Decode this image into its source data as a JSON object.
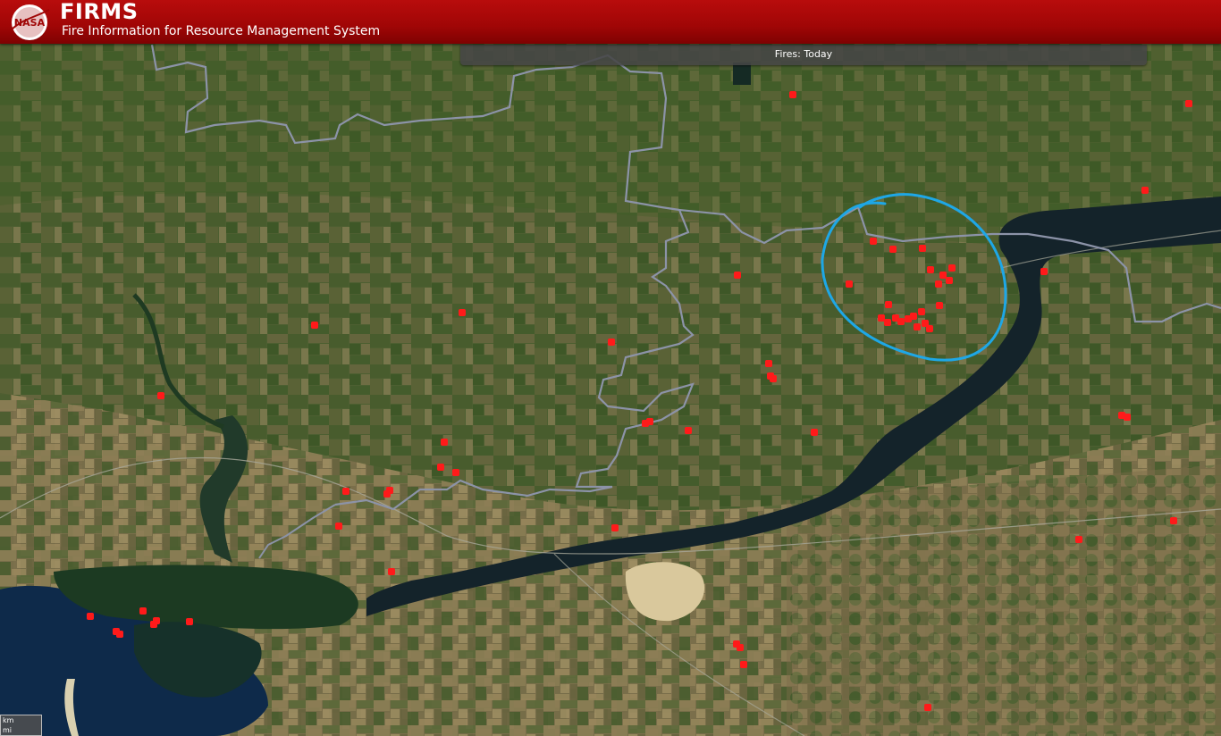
{
  "header": {
    "logo_text": "NASA",
    "title": "FIRMS",
    "subtitle": "Fire Information for Resource Management System",
    "background_color": "#a00606"
  },
  "fires_bar": {
    "label": "Fires: Today"
  },
  "map": {
    "basemap": "satellite imagery",
    "fire_marker_color": "#ff1a1a",
    "annotation_color": "#1ea7e6",
    "annotation_shape": "hand-drawn circle"
  },
  "scale": {
    "km_label": "km",
    "mi_label": "mi"
  }
}
